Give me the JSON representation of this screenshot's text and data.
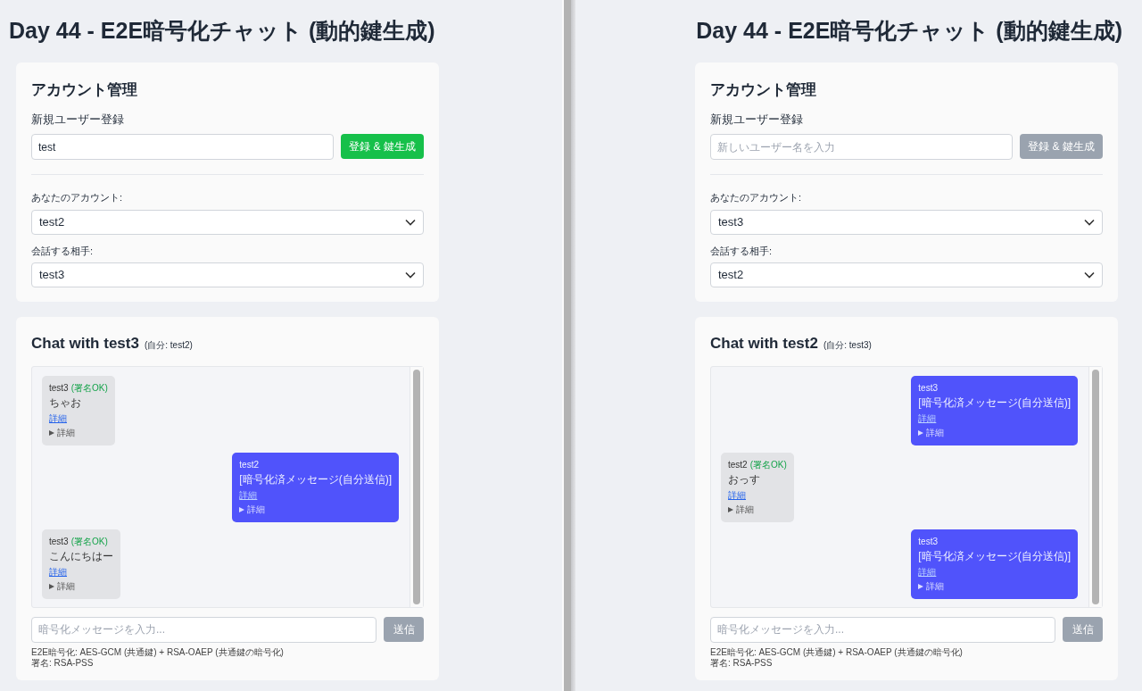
{
  "panes": [
    {
      "title": "Day 44 - E2E暗号化チャット (動的鍵生成)",
      "account": {
        "heading": "アカウント管理",
        "new_user_label": "新規ユーザー登録",
        "username_field": {
          "value": "test"
        },
        "register_button": {
          "label": "登録 & 鍵生成",
          "disabled": false
        },
        "your_account_label": "あなたのアカウント:",
        "your_account": "test2",
        "partner_label": "会話する相手:",
        "partner": "test3"
      },
      "chat": {
        "title": "Chat with test3",
        "subtitle": "(自分: test2)",
        "messages": [
          {
            "own": false,
            "sender": "test3",
            "signature": "(署名OK)",
            "text": "ちゃお",
            "link": "詳細",
            "details": "詳細"
          },
          {
            "own": true,
            "sender": "test2",
            "text": "[暗号化済メッセージ(自分送信)]",
            "link": "詳細",
            "details": "詳細"
          },
          {
            "own": false,
            "sender": "test3",
            "signature": "(署名OK)",
            "text": "こんにちはー",
            "link": "詳細",
            "details": "詳細"
          }
        ],
        "message_field": {
          "placeholder": "暗号化メッセージを入力..."
        },
        "send_button": {
          "label": "送信",
          "disabled": true
        },
        "footer": [
          "E2E暗号化: AES-GCM (共通鍵) + RSA-OAEP (共通鍵の暗号化)",
          "署名: RSA-PSS"
        ]
      }
    },
    {
      "title": "Day 44 - E2E暗号化チャット (動的鍵生成)",
      "account": {
        "heading": "アカウント管理",
        "new_user_label": "新規ユーザー登録",
        "username_field": {
          "placeholder": "新しいユーザー名を入力"
        },
        "register_button": {
          "label": "登録 & 鍵生成",
          "disabled": true
        },
        "your_account_label": "あなたのアカウント:",
        "your_account": "test3",
        "partner_label": "会話する相手:",
        "partner": "test2"
      },
      "chat": {
        "title": "Chat with test2",
        "subtitle": "(自分: test3)",
        "messages": [
          {
            "own": true,
            "sender": "test3",
            "text": "[暗号化済メッセージ(自分送信)]",
            "link": "詳細",
            "details": "詳細"
          },
          {
            "own": false,
            "sender": "test2",
            "signature": "(署名OK)",
            "text": "おっす",
            "link": "詳細",
            "details": "詳細"
          },
          {
            "own": true,
            "sender": "test3",
            "text": "[暗号化済メッセージ(自分送信)]",
            "link": "詳細",
            "details": "詳細"
          }
        ],
        "message_field": {
          "placeholder": "暗号化メッセージを入力..."
        },
        "send_button": {
          "label": "送信",
          "disabled": true
        },
        "footer": [
          "E2E暗号化: AES-GCM (共通鍵) + RSA-OAEP (共通鍵の暗号化)",
          "署名: RSA-PSS"
        ]
      }
    }
  ]
}
